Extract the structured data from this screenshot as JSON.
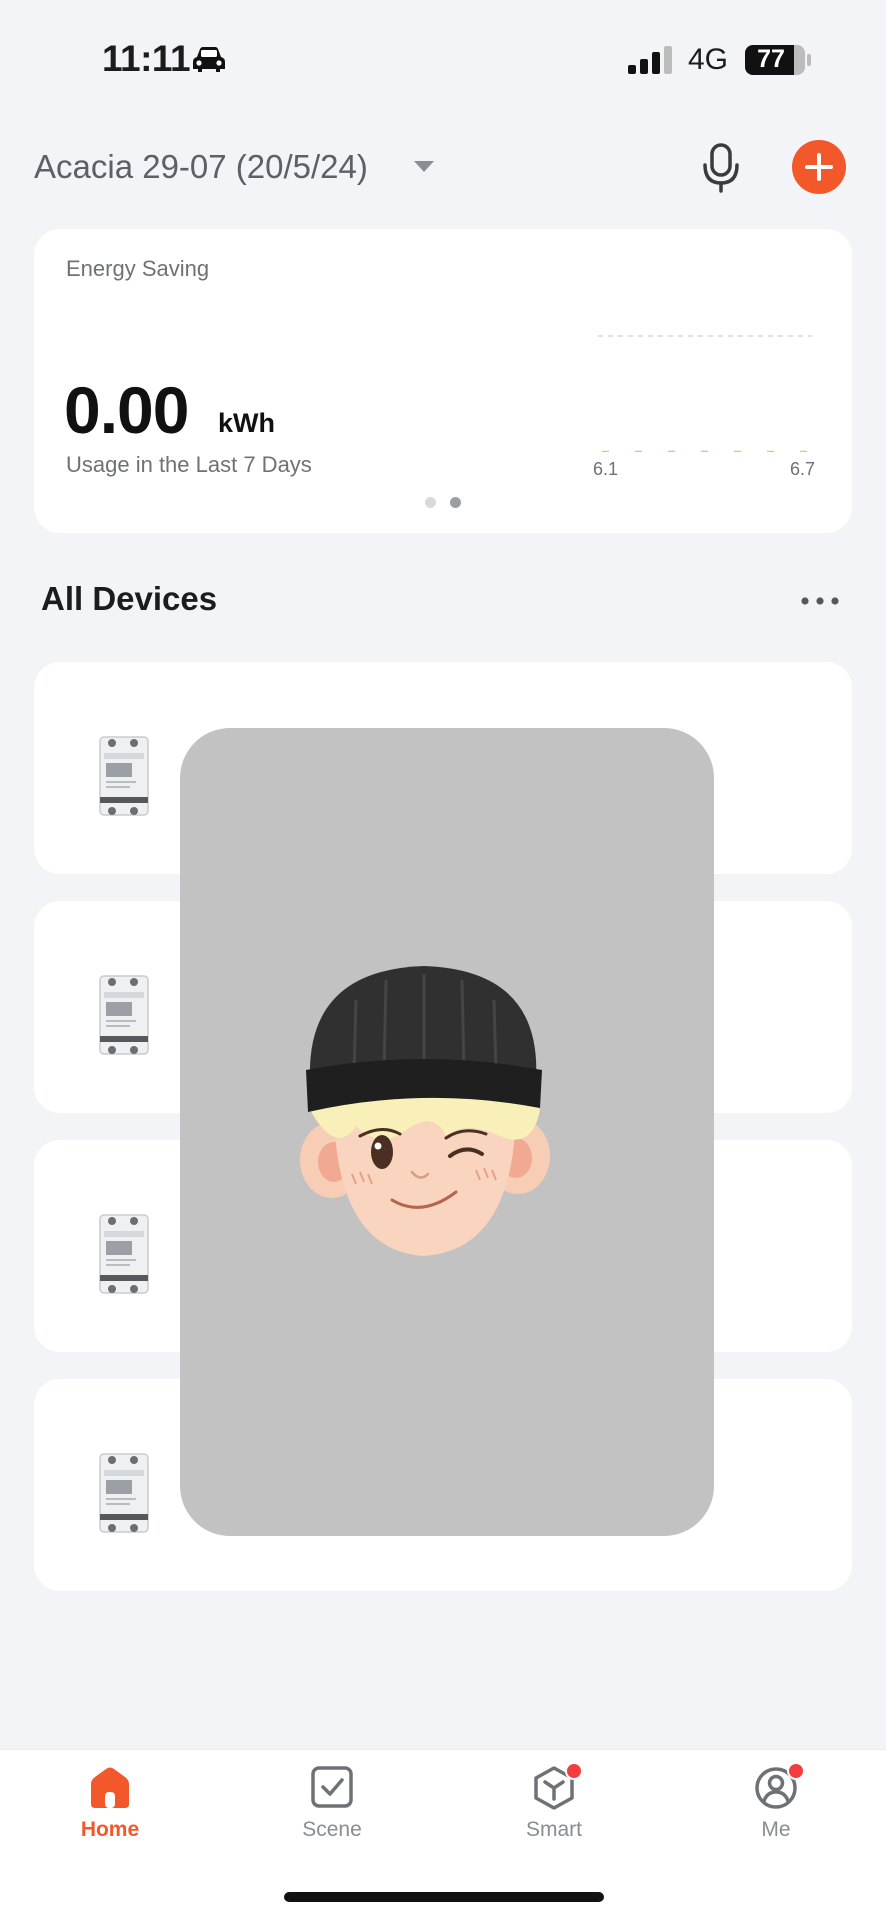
{
  "status_bar": {
    "time": "11:11",
    "network": "4G",
    "battery": "77",
    "icons": [
      "car-icon",
      "signal-icon",
      "battery-icon"
    ]
  },
  "header": {
    "home_name": "Acacia 29-07 (20/5/24)",
    "icons": [
      "chevron-down-icon",
      "microphone-icon",
      "plus-icon"
    ]
  },
  "energy_card": {
    "label": "Energy Saving",
    "value": "0.00",
    "unit": "kWh",
    "subtitle": "Usage in the Last 7 Days",
    "chart_x_start": "6.1",
    "chart_x_end": "6.7",
    "page_index": 2,
    "page_count": 2
  },
  "devices_section": {
    "title": "All Devices",
    "items": [
      {
        "icon": "energy-meter-image"
      },
      {
        "icon": "energy-meter-image"
      },
      {
        "icon": "energy-meter-image"
      },
      {
        "icon": "energy-meter-image"
      }
    ]
  },
  "overlay": {
    "icon": "winking-avatar-icon"
  },
  "tab_bar": {
    "tabs": [
      {
        "label": "Home",
        "active": true
      },
      {
        "label": "Scene",
        "active": false
      },
      {
        "label": "Smart",
        "active": false,
        "badge": true
      },
      {
        "label": "Me",
        "active": false,
        "badge": true
      }
    ]
  },
  "colors": {
    "accent": "#f2582a",
    "background": "#f3f4f8",
    "card": "#ffffff",
    "overlay": "#c2c2c2",
    "badge": "#f43d3d"
  }
}
